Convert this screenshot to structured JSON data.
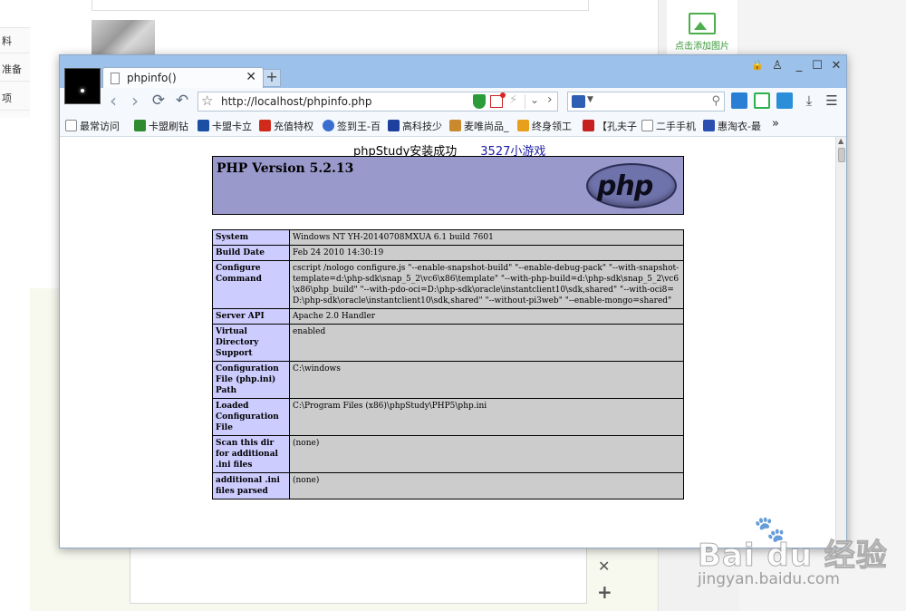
{
  "background": {
    "left_items": [
      "料",
      "准备",
      "项"
    ],
    "add_image_label": "点击添加图片"
  },
  "watermark": {
    "brand": "Bai du 经验",
    "sub": "jingyan.baidu.com"
  },
  "browser": {
    "tab_title": "phpinfo()",
    "address": "http://localhost/phpinfo.php",
    "bookmarks": [
      "最常访问",
      "卡盟刷钻",
      "卡盟卡立",
      "充值特权",
      "签到王-百",
      "高科技少",
      "麦唯尚品_",
      "终身领工",
      "【孔夫子",
      "二手手机",
      "惠淘衣-最"
    ],
    "bookmarks_more": "»"
  },
  "page": {
    "top_text": "phpStudy安装成功",
    "top_link": "3527小游戏",
    "php_version": "PHP Version 5.2.13",
    "logo_text": "php",
    "rows": [
      {
        "key": "System",
        "value": "Windows NT YH-20140708MXUA 6.1 build 7601"
      },
      {
        "key": "Build Date",
        "value": "Feb 24 2010 14:30:19"
      },
      {
        "key": "Configure Command",
        "value": "cscript /nologo configure.js \"--enable-snapshot-build\" \"--enable-debug-pack\" \"--with-snapshot-template=d:\\php-sdk\\snap_5_2\\vc6\\x86\\template\" \"--with-php-build=d:\\php-sdk\\snap_5_2\\vc6\\x86\\php_build\" \"--with-pdo-oci=D:\\php-sdk\\oracle\\instantclient10\\sdk,shared\" \"--with-oci8=D:\\php-sdk\\oracle\\instantclient10\\sdk,shared\" \"--without-pi3web\" \"--enable-mongo=shared\""
      },
      {
        "key": "Server API",
        "value": "Apache 2.0 Handler"
      },
      {
        "key": "Virtual Directory Support",
        "value": "enabled"
      },
      {
        "key": "Configuration File (php.ini) Path",
        "value": "C:\\windows"
      },
      {
        "key": "Loaded Configuration File",
        "value": "C:\\Program Files (x86)\\phpStudy\\PHP5\\php.ini"
      },
      {
        "key": "Scan this dir for additional .ini files",
        "value": "(none)"
      },
      {
        "key": "additional .ini files parsed",
        "value": "(none)"
      }
    ]
  }
}
